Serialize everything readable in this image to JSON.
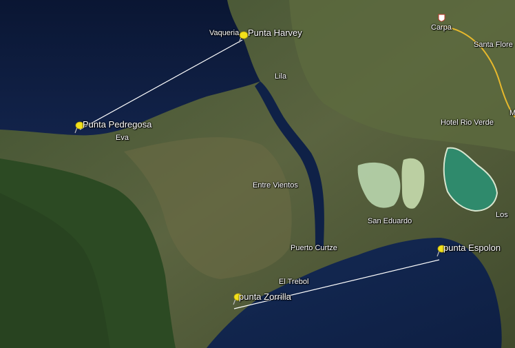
{
  "map": {
    "colors": {
      "water": "#0d1d3f",
      "land": "#4a5a33",
      "route_line": "#ffffff",
      "pin": "#f2e11b",
      "lagoon": "#2f8a6c",
      "salt_flat": "#b8d7b0"
    },
    "placemarks": [
      {
        "name": "Punta Harvey",
        "icon": "yellow-pushpin-icon"
      },
      {
        "name": "Punta Pedregosa",
        "icon": "yellow-pushpin-icon"
      },
      {
        "name": "punta Zorrilla",
        "icon": "yellow-pushpin-icon"
      },
      {
        "name": "punta Espolon",
        "icon": "yellow-pushpin-icon"
      }
    ],
    "places": {
      "vaqueria": "Vaqueria",
      "carpa": "Carpa",
      "santa_flore": "Santa Flore",
      "lila": "Lila",
      "hotel_rio_verde": "Hotel Rio Verde",
      "eva": "Eva",
      "entre_vientos": "Entre Vientos",
      "san_eduardo": "San Eduardo",
      "puerto_curtze": "Puerto Curtze",
      "el_trebol": "El Trebol",
      "los": "Los",
      "m": "M"
    },
    "road_shield_icon": "route-shield-icon"
  }
}
